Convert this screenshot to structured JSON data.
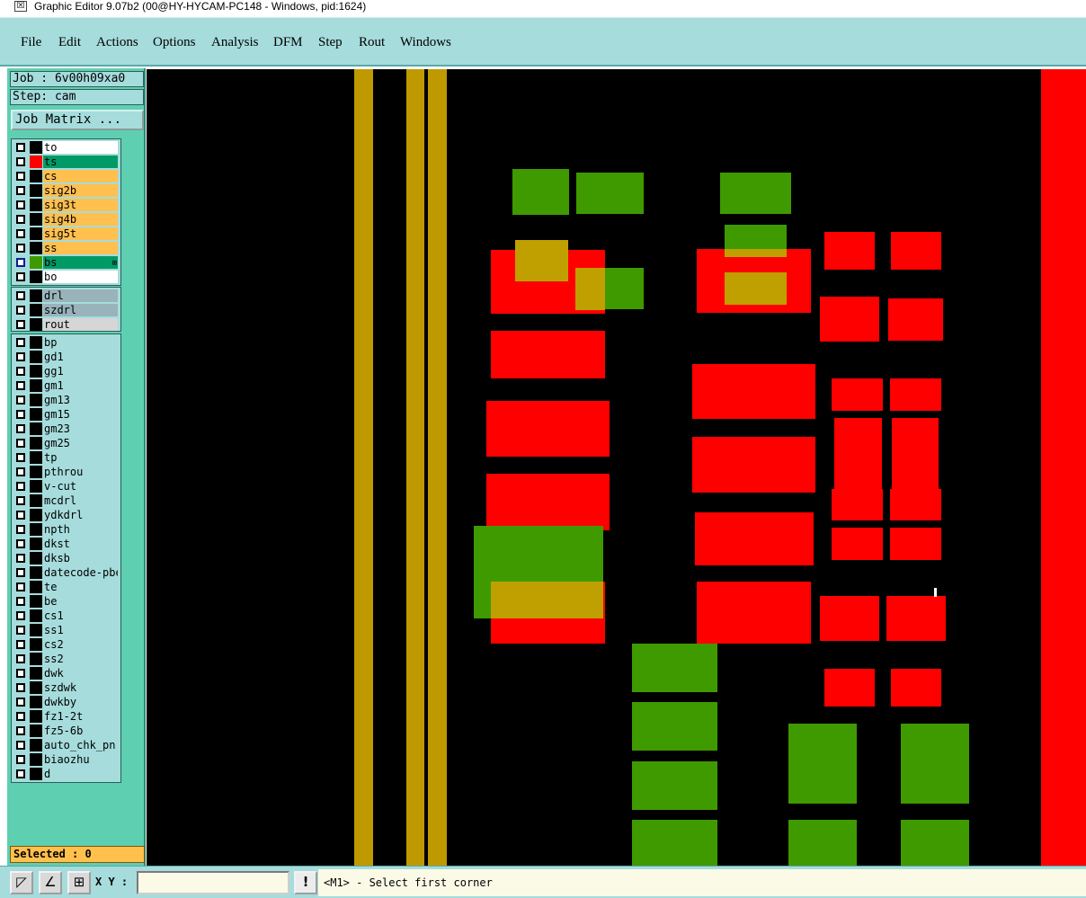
{
  "window": {
    "title": "Graphic Editor 9.07b2 (00@HY-HYCAM-PC148 - Windows, pid:1624)",
    "icon": "editor-app-icon"
  },
  "menu": [
    "File",
    "Edit",
    "Actions",
    "Options",
    "Analysis",
    "DFM",
    "Step",
    "Rout",
    "Windows"
  ],
  "job": {
    "label": "Job : 6v00h09xa0",
    "step": "Step: cam",
    "matrix_button": "Job Matrix ..."
  },
  "layers": {
    "board": [
      {
        "name": "to",
        "color": "#ffffff",
        "swatch": "#000000"
      },
      {
        "name": "ts",
        "color": "#009a66",
        "swatch": "#ff0000"
      },
      {
        "name": "cs",
        "color": "#ffc050",
        "swatch": "#000000"
      },
      {
        "name": "sig2b",
        "color": "#ffc050",
        "swatch": "#000000"
      },
      {
        "name": "sig3t",
        "color": "#ffc050",
        "swatch": "#000000"
      },
      {
        "name": "sig4b",
        "color": "#ffc050",
        "swatch": "#000000"
      },
      {
        "name": "sig5t",
        "color": "#ffc050",
        "swatch": "#000000"
      },
      {
        "name": "ss",
        "color": "#ffc050",
        "swatch": "#000000"
      },
      {
        "name": "bs",
        "color": "#009a66",
        "swatch": "#3f9a00",
        "active": true,
        "indicator": "⊞"
      },
      {
        "name": "bo",
        "color": "#ffffff",
        "swatch": "#000000"
      }
    ],
    "drill": [
      {
        "name": "drl",
        "color": "#99b3bb",
        "swatch": "#000000"
      },
      {
        "name": "szdrl",
        "color": "#99b3bb",
        "swatch": "#000000"
      },
      {
        "name": "rout",
        "color": "#d6d6d6",
        "swatch": "#000000"
      }
    ],
    "misc": [
      "bp",
      "gd1",
      "gg1",
      "gm1",
      "gm13",
      "gm15",
      "gm23",
      "gm25",
      "tp",
      "pthrou",
      "v-cut",
      "mcdrl",
      "ydkdrl",
      "npth",
      "dkst",
      "dksb",
      "datecode-pbe",
      "te",
      "be",
      "cs1",
      "ss1",
      "cs2",
      "ss2",
      "dwk",
      "szdwk",
      "dwkby",
      "fz1-2t",
      "fz5-6b",
      "auto_chk_pn",
      "biaozhu",
      "d"
    ]
  },
  "status": {
    "selected": "Selected : 0"
  },
  "bottom": {
    "tool_icons": [
      "select-rect-icon",
      "measure-icon",
      "snap-grid-icon"
    ],
    "xy_label": "X Y :",
    "xy_value": "",
    "prompt_icon": "!",
    "prompt": "<M1> - Select first corner"
  },
  "colors": {
    "canvas_bg": "#000000",
    "panel_bg": "#5fcfb2",
    "menu_bg": "#a6dcdc",
    "top_layer_pad": "#ff0000",
    "bottom_layer_pad": "#3f9a00",
    "overlap": "#bfa000",
    "trace": "#bf9900"
  }
}
